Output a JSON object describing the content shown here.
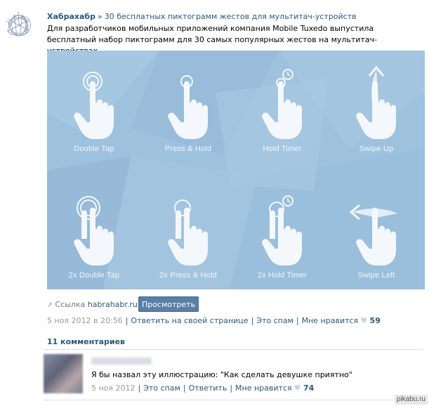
{
  "post": {
    "author": "Хабрахабр",
    "separator": "»",
    "title": "30 бесплатных пиктограмм жестов для мультитач-устройств",
    "text": "Для разработчиков мобильных приложений компания Mobile Tuxedo выпустила бесплатный набор пиктограмм для 30 самых популярных жестов на мультитач-устройствах..."
  },
  "gestures": [
    {
      "label": "Double Tap",
      "icon": "double-tap-icon"
    },
    {
      "label": "Press & Hold",
      "icon": "press-hold-icon"
    },
    {
      "label": "Hold Timer",
      "icon": "hold-timer-icon"
    },
    {
      "label": "Swipe Up",
      "icon": "swipe-up-icon"
    },
    {
      "label": "2x Double Tap",
      "icon": "2x-double-tap-icon"
    },
    {
      "label": "2x Press & Hold",
      "icon": "2x-press-hold-icon"
    },
    {
      "label": "2x Hold Timer",
      "icon": "2x-hold-timer-icon"
    },
    {
      "label": "Swipe Left",
      "icon": "swipe-left-icon"
    }
  ],
  "link": {
    "label": "Ссылка",
    "domain": "habrahabr.ru",
    "button": "Просмотреть"
  },
  "meta": {
    "date": "5 ноя 2012 в 20:56",
    "reply": "Ответить на своей странице",
    "spam": "Это спам",
    "dislike": "Мне нравится",
    "likes": "59"
  },
  "comments": {
    "title": "11 комментариев",
    "items": [
      {
        "text": "Я бы назвал эту иллюстрацию: \"Как сделать девушке приятно\"",
        "date": "5 ноя 2012",
        "spam": "Это спам",
        "reply": "Ответить",
        "like": "Мне нравится",
        "likes": "74"
      }
    ]
  },
  "watermark": "pikabu.ru",
  "colors": {
    "link": "#2b587a",
    "panel": "#9ec1de",
    "button": "#5a7fa6"
  }
}
